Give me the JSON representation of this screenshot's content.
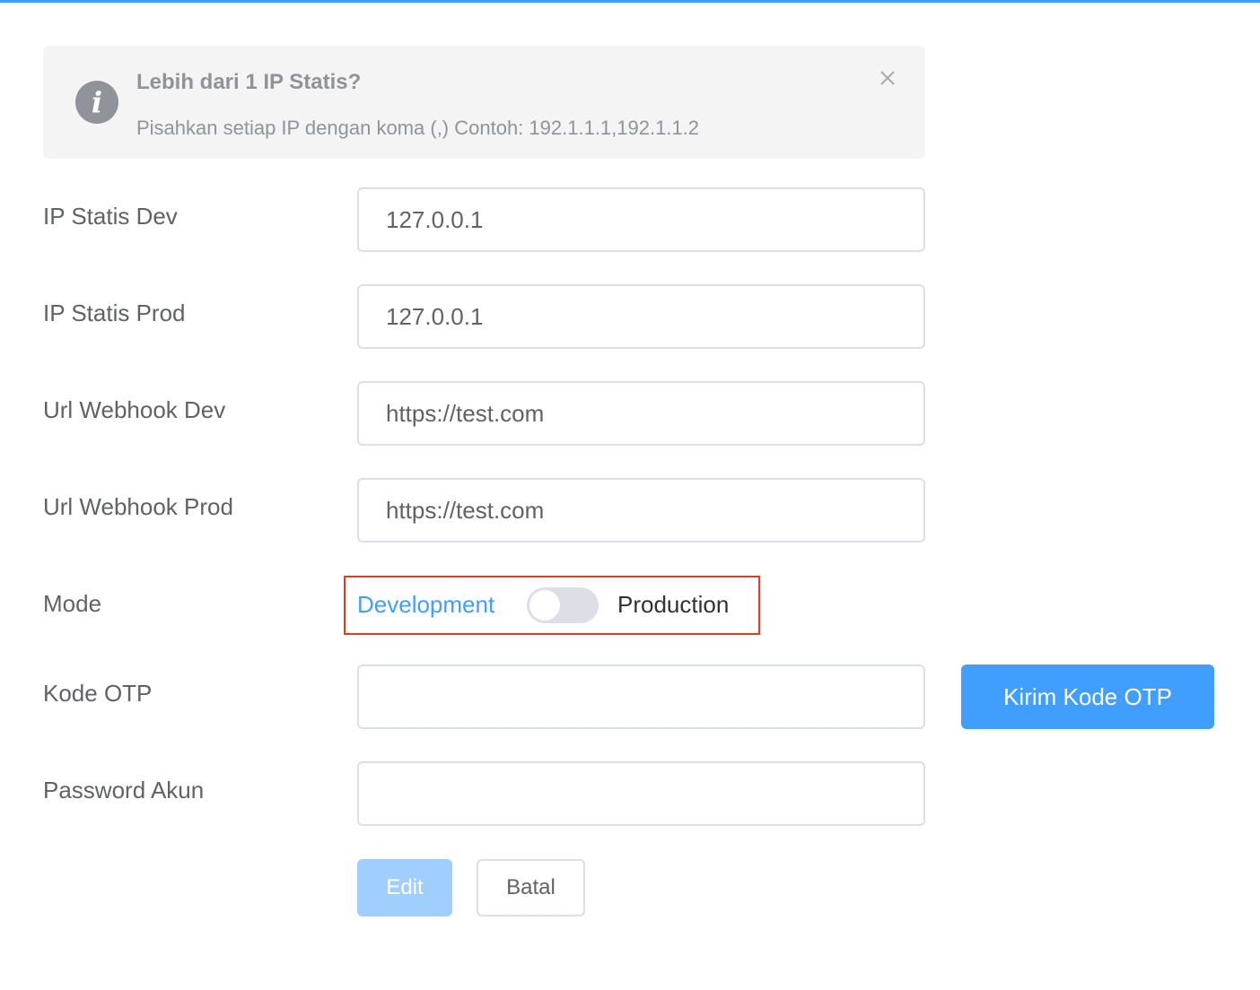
{
  "alert": {
    "title": "Lebih dari 1 IP Statis?",
    "description": "Pisahkan setiap IP dengan koma (,) Contoh: 192.1.1.1,192.1.1.2",
    "icon": "info-icon",
    "close_icon": "close-icon"
  },
  "form": {
    "ip_dev": {
      "label": "IP Statis Dev",
      "value": "127.0.0.1"
    },
    "ip_prod": {
      "label": "IP Statis Prod",
      "value": "127.0.0.1"
    },
    "webhook_dev": {
      "label": "Url Webhook Dev",
      "value": "https://test.com"
    },
    "webhook_prod": {
      "label": "Url Webhook Prod",
      "value": "https://test.com"
    },
    "mode": {
      "label": "Mode",
      "left_option": "Development",
      "right_option": "Production",
      "active_option": "Development",
      "switch_on": false
    },
    "otp": {
      "label": "Kode OTP",
      "value": "",
      "button_label": "Kirim Kode OTP"
    },
    "password": {
      "label": "Password Akun",
      "value": ""
    }
  },
  "actions": {
    "edit_label": "Edit",
    "edit_disabled": true,
    "cancel_label": "Batal"
  },
  "colors": {
    "primary": "#409eff",
    "primary_disabled": "#a0cfff",
    "highlight_border": "#e23b22",
    "alert_bg": "#f4f4f5"
  }
}
